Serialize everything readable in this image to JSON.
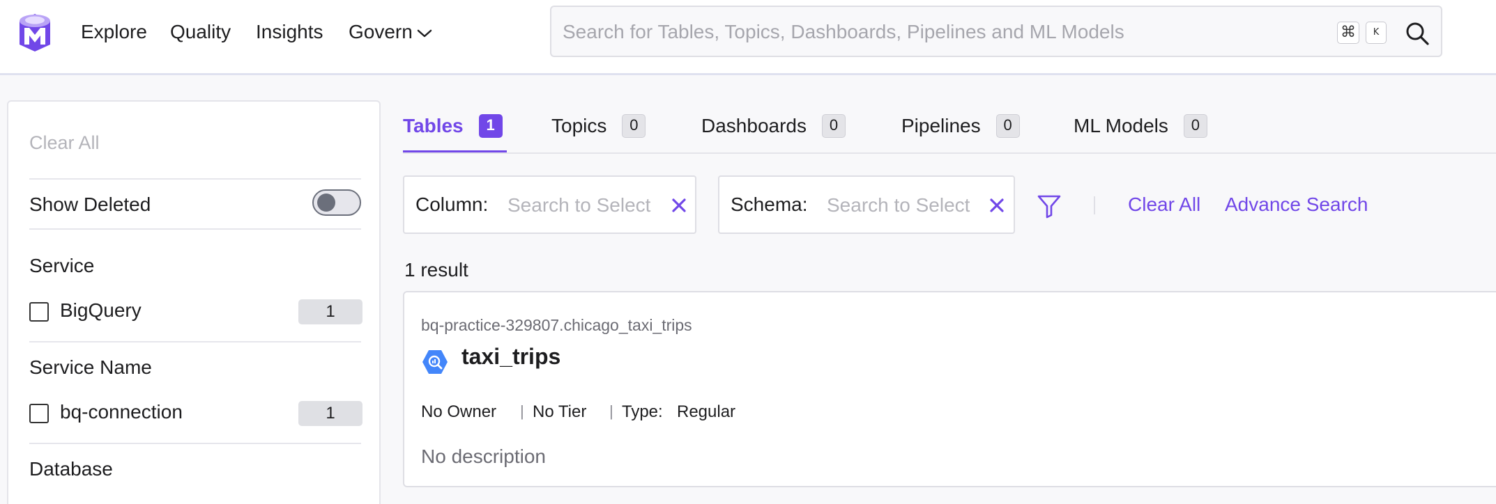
{
  "nav": {
    "items": [
      "Explore",
      "Quality",
      "Insights",
      "Govern"
    ]
  },
  "search": {
    "placeholder": "Search for Tables, Topics, Dashboards, Pipelines and ML Models",
    "shortcut_cmd": "⌘",
    "shortcut_key": "K"
  },
  "filters": {
    "clear_all": "Clear All",
    "show_deleted": "Show Deleted",
    "show_deleted_on": false,
    "groups": [
      {
        "title": "Service",
        "options": [
          {
            "label": "BigQuery",
            "count": "1"
          }
        ]
      },
      {
        "title": "Service Name",
        "options": [
          {
            "label": "bq-connection",
            "count": "1"
          }
        ]
      },
      {
        "title": "Database",
        "options": []
      }
    ]
  },
  "tabs": [
    {
      "label": "Tables",
      "count": "1",
      "active": true
    },
    {
      "label": "Topics",
      "count": "0"
    },
    {
      "label": "Dashboards",
      "count": "0"
    },
    {
      "label": "Pipelines",
      "count": "0"
    },
    {
      "label": "ML Models",
      "count": "0"
    }
  ],
  "chips": {
    "column": {
      "key": "Column:",
      "placeholder": "Search to Select"
    },
    "schema": {
      "key": "Schema:",
      "placeholder": "Search to Select"
    }
  },
  "actions": {
    "clear_all": "Clear All",
    "advance_search": "Advance Search"
  },
  "results": {
    "count_text": "1 result",
    "items": [
      {
        "path": "bq-practice-329807.chicago_taxi_trips",
        "name": "taxi_trips",
        "owner": "No Owner",
        "tier": "No Tier",
        "type_key": "Type:",
        "type_value": "Regular",
        "description": "No description"
      }
    ]
  },
  "colors": {
    "accent": "#7147e8",
    "bigquery_icon": "#4386fa"
  }
}
